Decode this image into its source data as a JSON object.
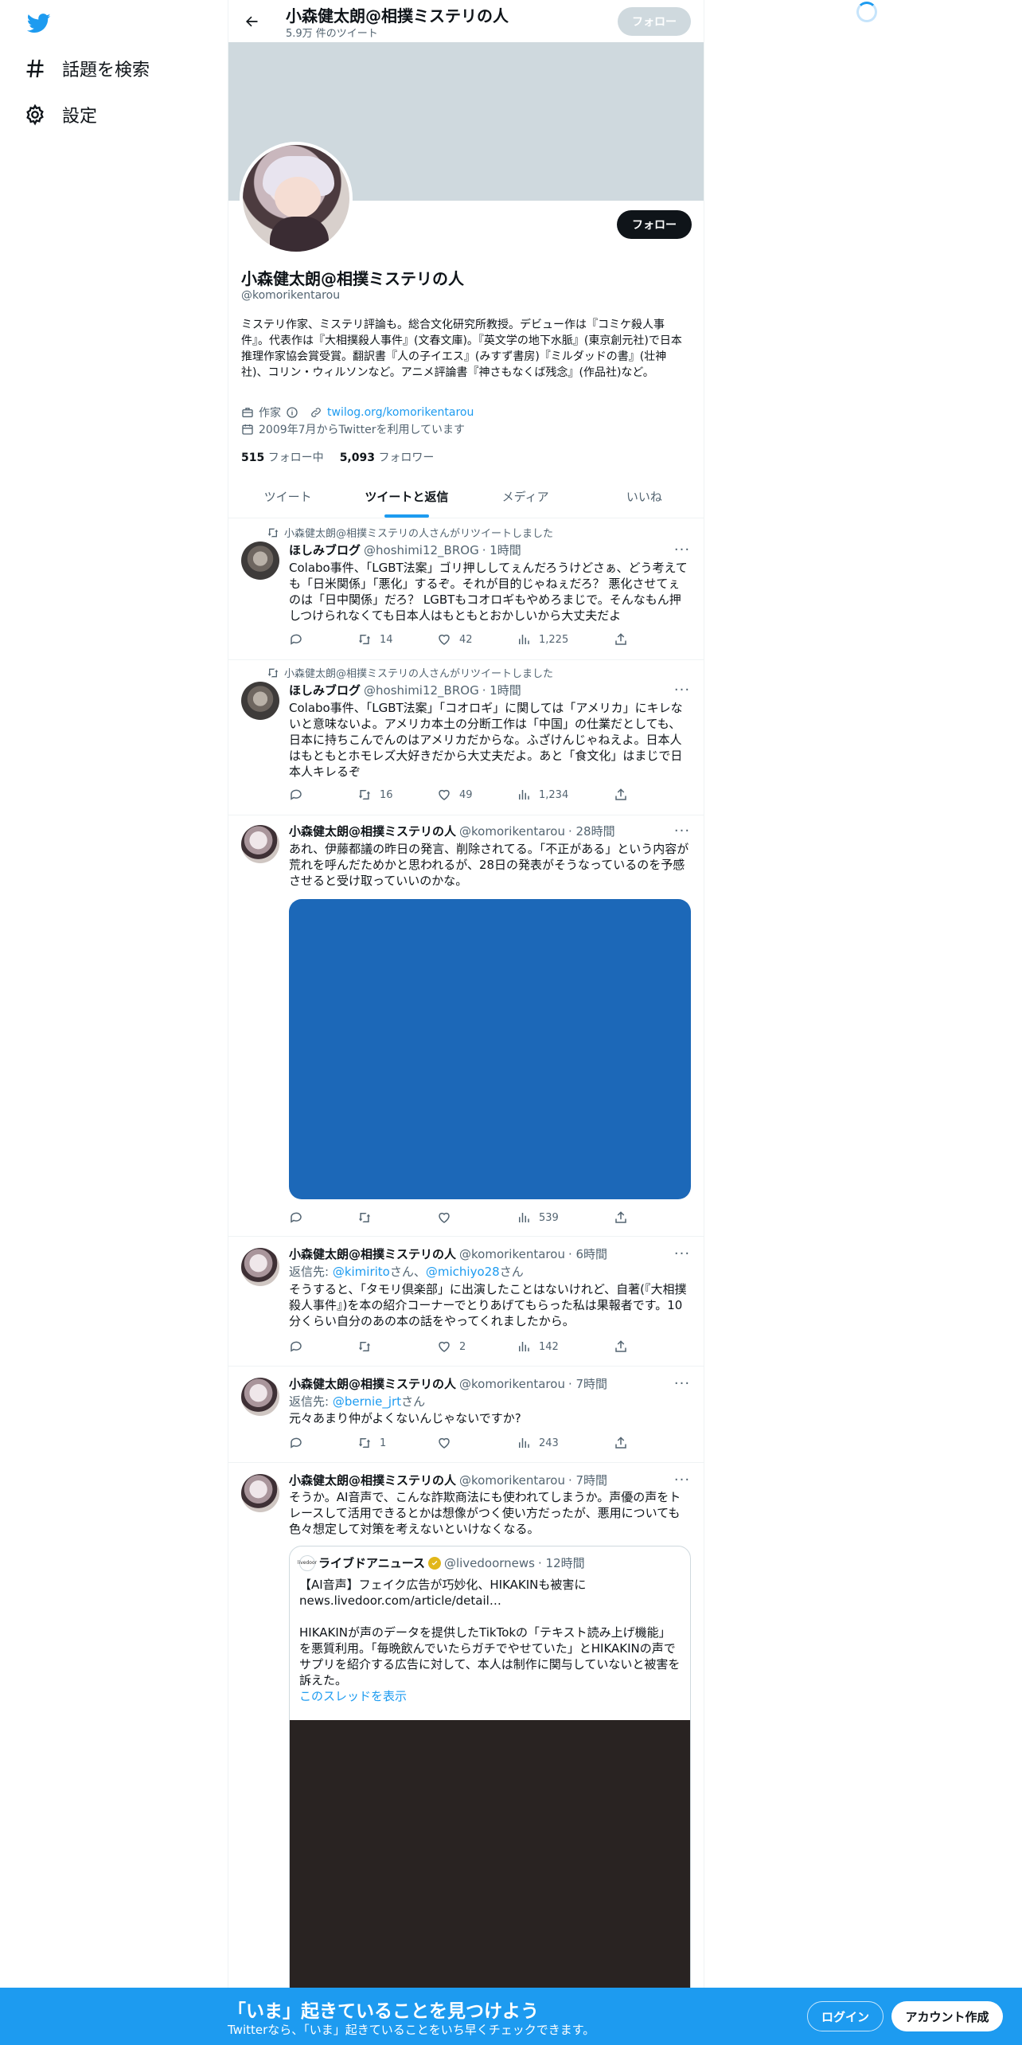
{
  "nav": {
    "explore": "話題を検索",
    "settings": "設定"
  },
  "topbar": {
    "name": "小森健太朗@相撲ミステリの人",
    "tweet_count": "5.9万 件のツイート",
    "follow": "フォロー"
  },
  "profile": {
    "name": "小森健太朗@相撲ミステリの人",
    "handle": "@komorikentarou",
    "follow": "フォロー",
    "bio": "ミステリ作家、ミステリ評論も。総合文化研究所教授。デビュー作は『コミケ殺人事件』。代表作は『大相撲殺人事件』(文春文庫)。『英文学の地下水脈』(東京創元社)で日本推理作家協会賞受賞。翻訳書『人の子イエス』(みすず書房)『ミルダッドの書』(壮神社)、コリン・ウィルソンなど。アニメ評論書『神さもなくば残念』(作品社)など。",
    "job": "作家",
    "link": "twilog.org/komorikentarou",
    "joined": "2009年7月からTwitterを利用しています",
    "following_count": "515",
    "following_label": "フォロー中",
    "followers_count": "5,093",
    "followers_label": "フォロワー"
  },
  "tabs": [
    "ツイート",
    "ツイートと返信",
    "メディア",
    "いいね"
  ],
  "tweets": [
    {
      "retweeted_by": "小森健太朗@相撲ミステリの人さんがリツイートしました",
      "name": "ほしみブログ",
      "handle": "@hoshimi12_BROG",
      "time": "· 1時間",
      "text": "Colabo事件、「LGBT法案」ゴリ押ししてぇんだろうけどさぁ、どう考えても「日米関係」「悪化」するぞ。それが目的じゃねぇだろ？ 悪化させてぇのは「日中関係」だろ？ LGBTもコオロギもやめろまじで。そんなもん押しつけられなくても日本人はもともとおかしいから大丈夫だよ",
      "retweets": "14",
      "likes": "42",
      "views": "1,225"
    },
    {
      "retweeted_by": "小森健太朗@相撲ミステリの人さんがリツイートしました",
      "name": "ほしみブログ",
      "handle": "@hoshimi12_BROG",
      "time": "· 1時間",
      "text": "Colabo事件、「LGBT法案」「コオロギ」に関しては「アメリカ」にキレないと意味ないよ。アメリカ本土の分断工作は「中国」の仕業だとしても、日本に持ちこんでんのはアメリカだからな。ふざけんじゃねえよ。日本人はもともとホモレズ大好きだから大丈夫だよ。あと「食文化」はまじで日本人キレるぞ",
      "retweets": "16",
      "likes": "49",
      "views": "1,234"
    },
    {
      "name": "小森健太朗@相撲ミステリの人",
      "handle": "@komorikentarou",
      "time": "· 28時間",
      "text": "あれ、伊藤都議の昨日の発言、削除されてる。「不正がある」という内容が荒れを呼んだためかと思われるが、28日の発表がそうなっているのを予感させると受け取っていいのかな。",
      "views": "539"
    },
    {
      "name": "小森健太朗@相撲ミステリの人",
      "handle": "@komorikentarou",
      "time": "· 6時間",
      "reply_prefix": "返信先: ",
      "reply_to1": "@kimirito",
      "reply_mid": "さん、",
      "reply_to2": "@michiyo28",
      "reply_suffix": "さん",
      "text": "そうすると、「タモリ倶楽部」に出演したことはないけれど、自著(『大相撲殺人事件』)を本の紹介コーナーでとりあげてもらった私は果報者です。10分くらい自分のあの本の話をやってくれましたから。",
      "likes": "2",
      "views": "142"
    },
    {
      "name": "小森健太朗@相撲ミステリの人",
      "handle": "@komorikentarou",
      "time": "· 7時間",
      "reply_prefix": "返信先: ",
      "reply_to1": "@bernie_jrt",
      "reply_suffix": "さん",
      "text": "元々あまり仲がよくないんじゃないですか?",
      "retweets": "1",
      "views": "243"
    },
    {
      "name": "小森健太朗@相撲ミステリの人",
      "handle": "@komorikentarou",
      "time": "· 7時間",
      "text": "そうか。AI音声で、こんな詐欺商法にも使われてしまうか。声優の声をトレースして活用できるとかは想像がつく使い方だったが、悪用についても色々想定して対策を考えないといけなくなる。",
      "quote": {
        "logo": "livedoor",
        "name": "ライブドアニュース",
        "handle": "@livedoornews",
        "time": "· 12時間",
        "text1": "【AI音声】フェイク広告が巧妙化、HIKAKINも被害に",
        "text2": "news.livedoor.com/article/detail…",
        "text3": "HIKAKINが声のデータを提供したTikTokの「テキスト読み上げ機能」を悪質利用。「毎晩飲んでいたらガチでやせていた」とHIKAKINの声でサプリを紹介する広告に対して、本人は制作に関与していないと被害を訴えた。",
        "thread": "このスレッドを表示"
      }
    }
  ],
  "bottom": {
    "title": "「いま」起きていることを見つけよう",
    "subtitle": "Twitterなら、「いま」起きていることをいち早くチェックできます。",
    "login": "ログイン",
    "signup": "アカウント作成"
  },
  "colors": {
    "accent": "#1d9bf0",
    "banner": "#cfd9de",
    "media": "#1c68b8"
  }
}
